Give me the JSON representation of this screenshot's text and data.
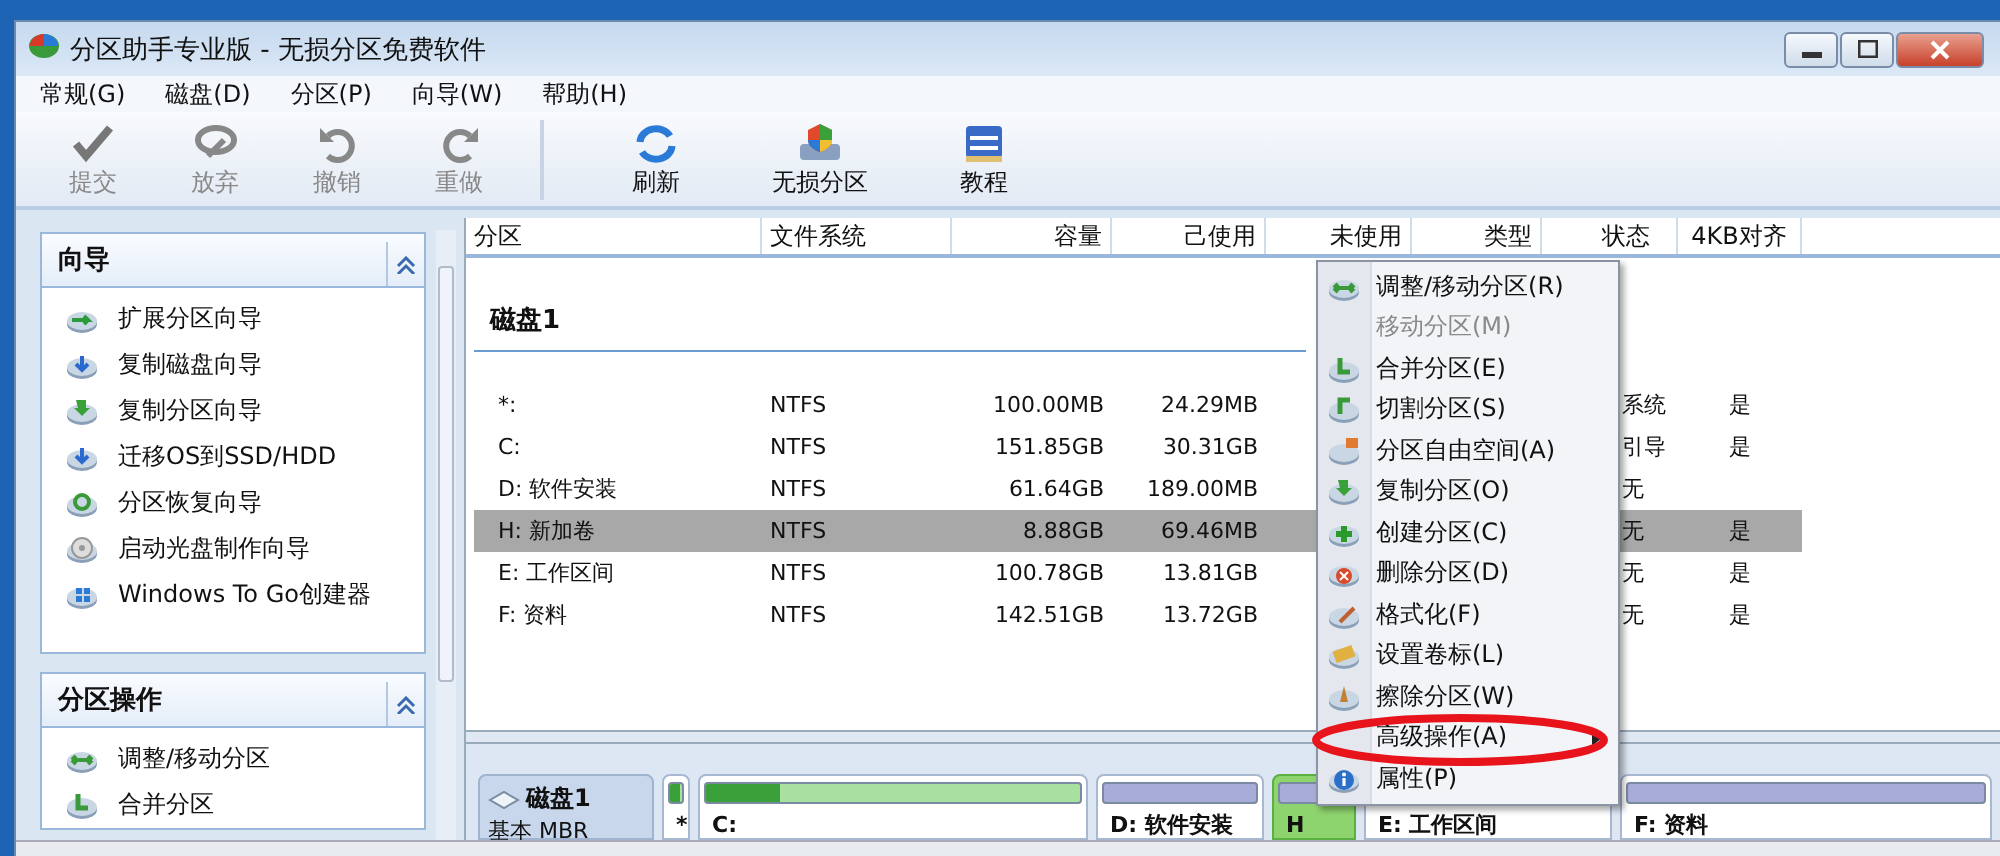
{
  "window": {
    "title": "分区助手专业版 - 无损分区免费软件"
  },
  "menu_bar": [
    "常规(G)",
    "磁盘(D)",
    "分区(P)",
    "向导(W)",
    "帮助(H)"
  ],
  "toolbar": [
    {
      "label": "提交",
      "disabled": true
    },
    {
      "label": "放弃",
      "disabled": true
    },
    {
      "label": "撤销",
      "disabled": true
    },
    {
      "label": "重做",
      "disabled": true
    },
    {
      "label": "刷新",
      "disabled": false
    },
    {
      "label": "无损分区",
      "disabled": false
    },
    {
      "label": "教程",
      "disabled": false
    }
  ],
  "sidebar": [
    {
      "title": "向导",
      "items": [
        "扩展分区向导",
        "复制磁盘向导",
        "复制分区向导",
        "迁移OS到SSD/HDD",
        "分区恢复向导",
        "启动光盘制作向导",
        "Windows To Go创建器"
      ]
    },
    {
      "title": "分区操作",
      "items": [
        "调整/移动分区",
        "合并分区"
      ]
    }
  ],
  "table": {
    "columns": [
      "分区",
      "文件系统",
      "容量",
      "己使用",
      "未使用",
      "类型",
      "状态",
      "4KB对齐"
    ],
    "group": "磁盘1",
    "rows": [
      {
        "partition": "*:",
        "fs": "NTFS",
        "capacity": "100.00MB",
        "used": "24.29MB",
        "status": "系统",
        "aligned": "是",
        "selected": false
      },
      {
        "partition": "C:",
        "fs": "NTFS",
        "capacity": "151.85GB",
        "used": "30.31GB",
        "status": "引导",
        "aligned": "是",
        "selected": false
      },
      {
        "partition": "D: 软件安装",
        "fs": "NTFS",
        "capacity": "61.64GB",
        "used": "189.00MB",
        "status": "无",
        "selected": false
      },
      {
        "partition": "H: 新加卷",
        "fs": "NTFS",
        "capacity": "8.88GB",
        "used": "69.46MB",
        "status": "无",
        "aligned": "是",
        "selected": true
      },
      {
        "partition": "E: 工作区间",
        "fs": "NTFS",
        "capacity": "100.78GB",
        "used": "13.81GB",
        "status": "无",
        "aligned": "是",
        "selected": false
      },
      {
        "partition": "F: 资料",
        "fs": "NTFS",
        "capacity": "142.51GB",
        "used": "13.72GB",
        "status": "无",
        "aligned": "是",
        "selected": false
      }
    ]
  },
  "disk_map": {
    "name": "磁盘1",
    "type": "基本 MBR",
    "segments": [
      {
        "label": "*",
        "kind": "primary",
        "level": 0.8,
        "selected": false
      },
      {
        "label": "C:",
        "kind": "primary",
        "level": 0.2,
        "selected": false
      },
      {
        "label": "D: 软件安装",
        "kind": "logical",
        "selected": false
      },
      {
        "label": "H",
        "kind": "logical",
        "selected": true
      },
      {
        "label": "E: 工作区间",
        "kind": "logical",
        "selected": false
      },
      {
        "label": "F: 资料",
        "kind": "logical",
        "selected": false
      }
    ]
  },
  "context_menu": [
    {
      "label": "调整/移动分区(R)",
      "disabled": false
    },
    {
      "label": "移动分区(M)",
      "disabled": true
    },
    {
      "label": "合并分区(E)",
      "disabled": false
    },
    {
      "label": "切割分区(S)",
      "disabled": false
    },
    {
      "label": "分区自由空间(A)",
      "disabled": false
    },
    {
      "label": "复制分区(O)",
      "disabled": false
    },
    {
      "label": "创建分区(C)",
      "disabled": false
    },
    {
      "label": "删除分区(D)",
      "disabled": false
    },
    {
      "label": "格式化(F)",
      "disabled": false
    },
    {
      "label": "设置卷标(L)",
      "disabled": false
    },
    {
      "label": "擦除分区(W)",
      "disabled": false
    },
    {
      "label": "高级操作(A)",
      "submenu": true,
      "circled": true,
      "disabled": false
    },
    {
      "label": "属性(P)",
      "disabled": false
    }
  ]
}
